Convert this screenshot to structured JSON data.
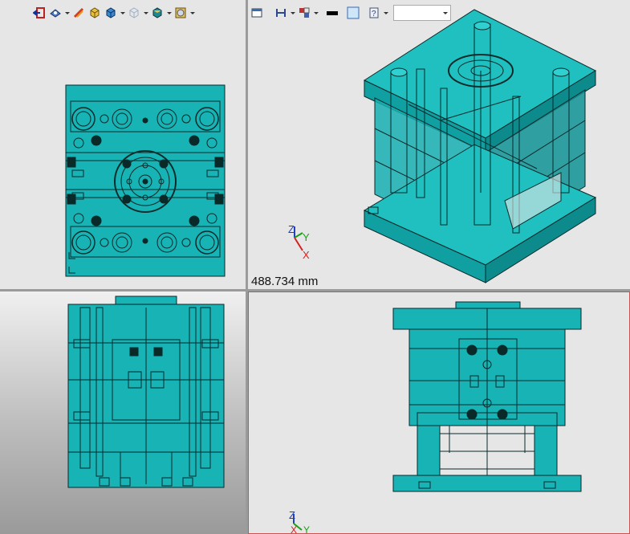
{
  "app": {
    "name": "3D CAD mold design viewport"
  },
  "toolbar_left": {
    "items": [
      {
        "icon": "exit-sketch-icon",
        "has_dropdown": false
      },
      {
        "icon": "view-orientation-icon",
        "has_dropdown": true
      },
      {
        "icon": "section-view-icon",
        "has_dropdown": false
      },
      {
        "icon": "shaded-edges-icon",
        "has_dropdown": false
      },
      {
        "icon": "shaded-icon",
        "has_dropdown": true
      },
      {
        "icon": "wireframe-icon",
        "has_dropdown": true
      },
      {
        "icon": "display-style-icon",
        "has_dropdown": true
      },
      {
        "icon": "appearance-icon",
        "has_dropdown": true
      }
    ]
  },
  "toolbar_right": {
    "items": [
      {
        "icon": "window-icon",
        "has_dropdown": false
      },
      {
        "icon": "align-icon",
        "has_dropdown": true
      },
      {
        "icon": "layout-icon",
        "has_dropdown": true
      },
      {
        "icon": "line-color-icon",
        "has_dropdown": false
      },
      {
        "icon": "fill-color-icon",
        "has_dropdown": false
      },
      {
        "icon": "help-icon",
        "has_dropdown": true
      }
    ],
    "combo_value": ""
  },
  "viewports": {
    "top_right": {
      "scale_text": "488.734 mm"
    },
    "axes": {
      "x": "X",
      "y": "Y",
      "z": "Z"
    }
  },
  "colors": {
    "model": "#17b3b5",
    "edge": "#0a2a2a",
    "active_border": "#d05050",
    "x_axis": "#d62020",
    "y_axis": "#18a018",
    "z_axis": "#2040c0"
  }
}
